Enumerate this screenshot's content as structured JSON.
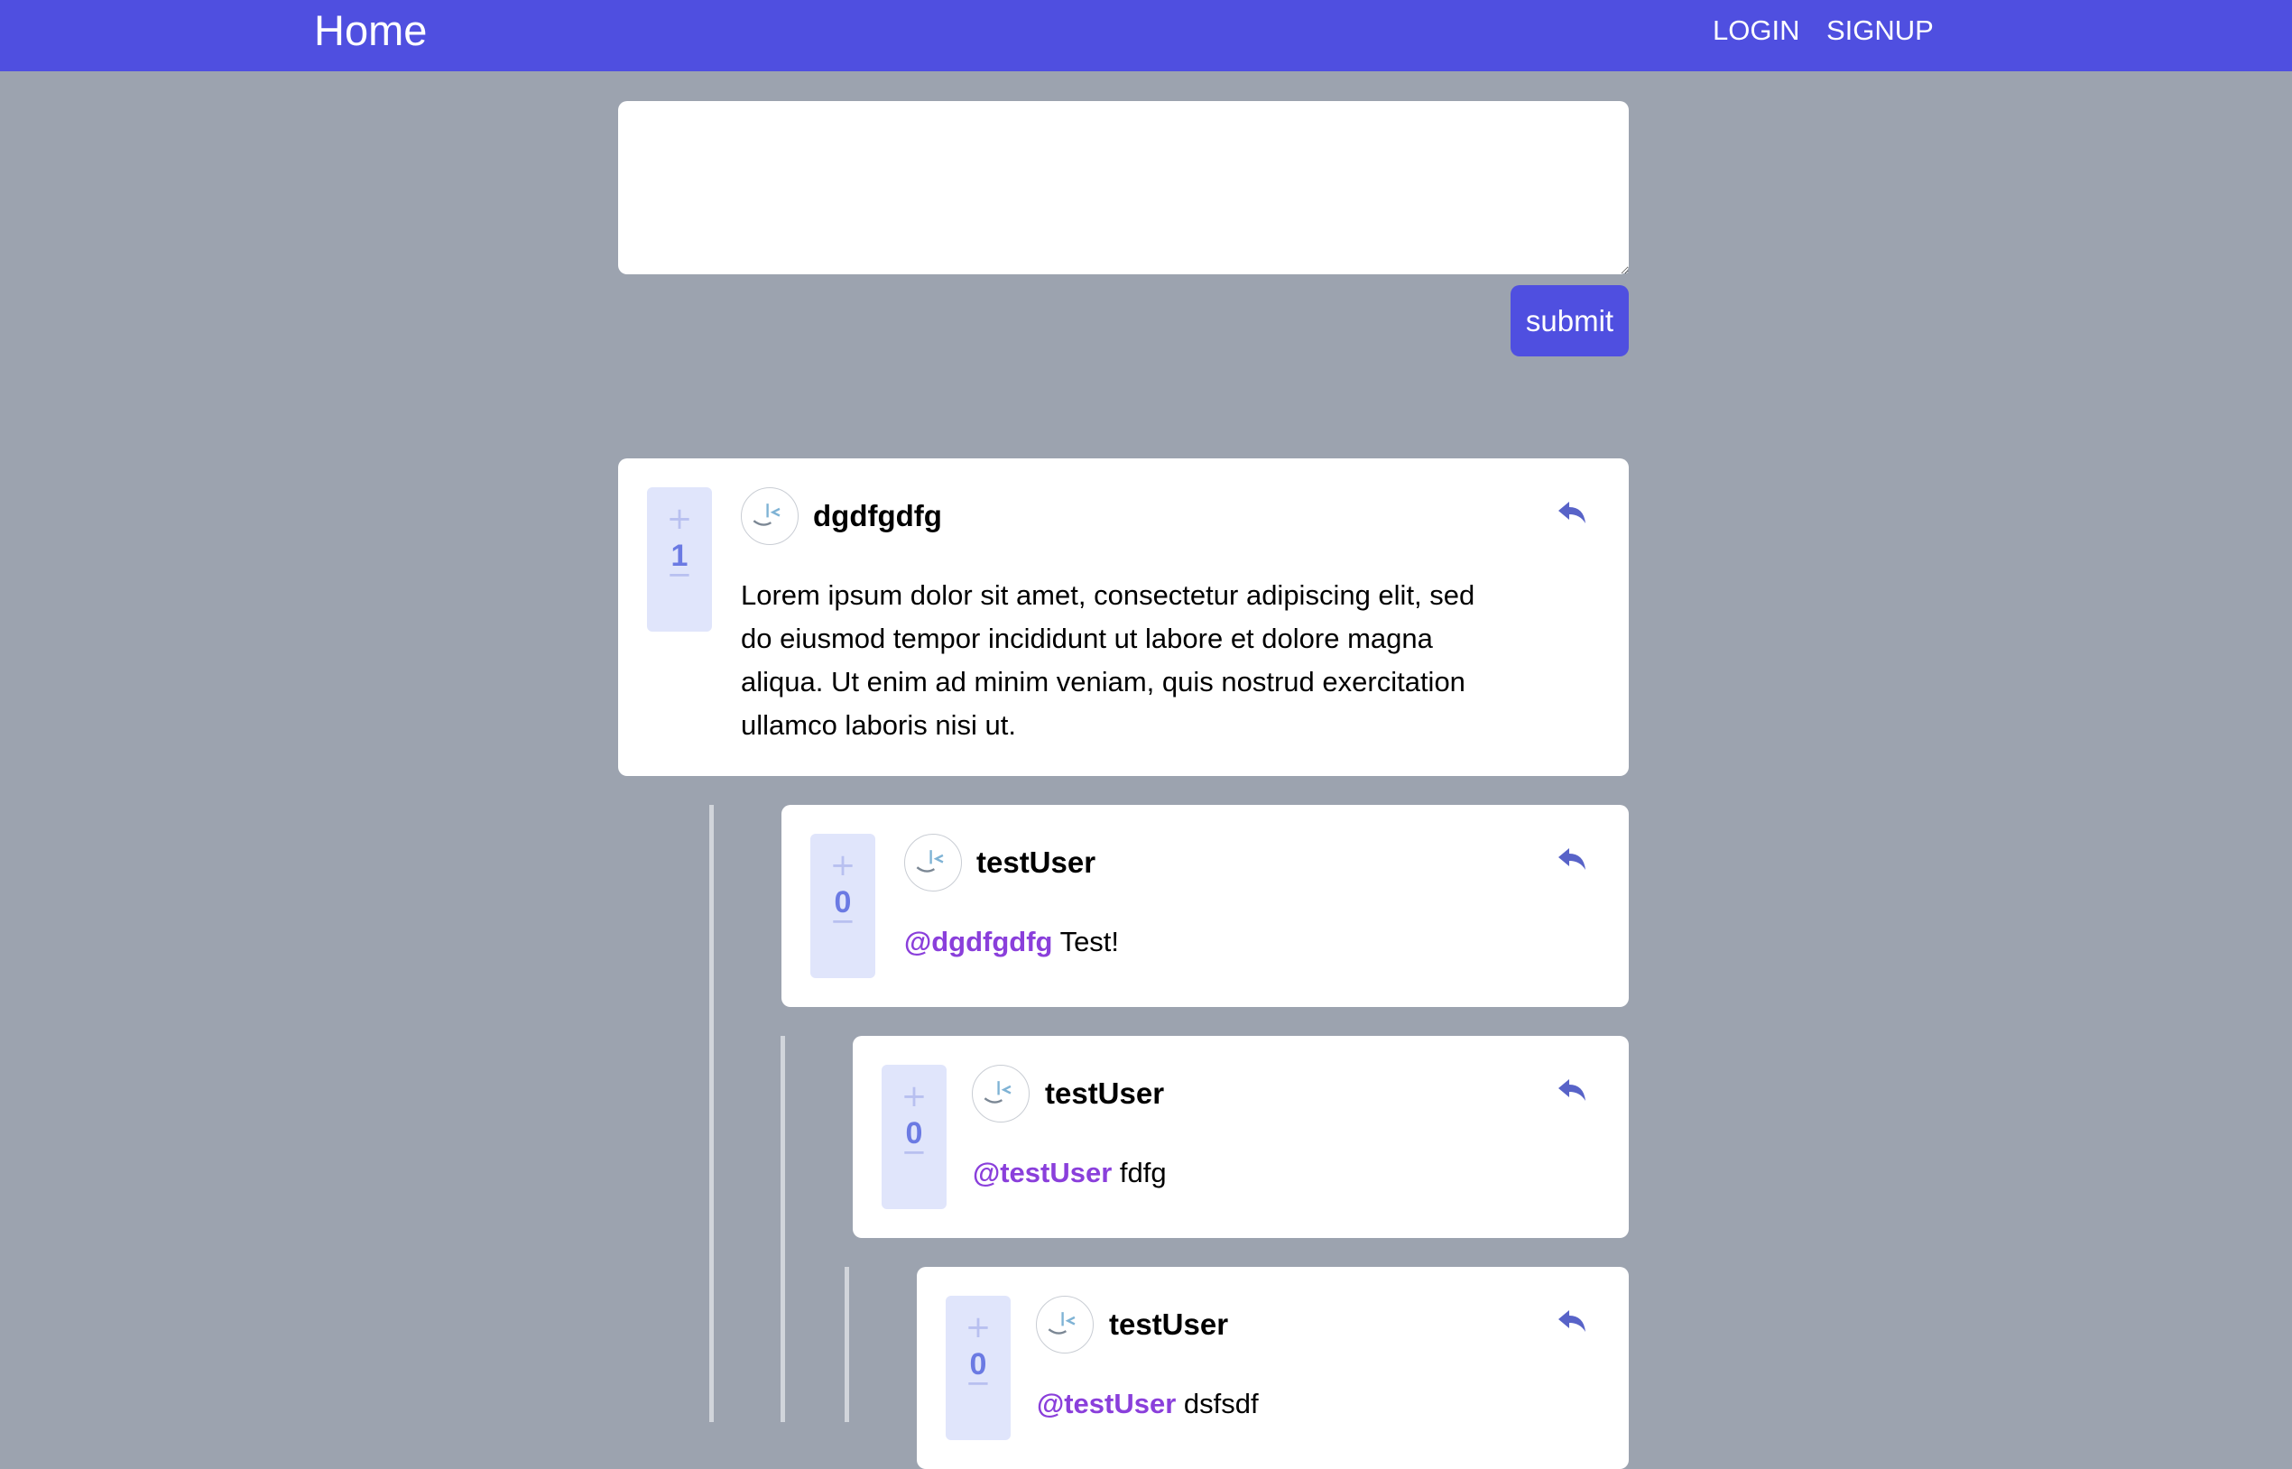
{
  "nav": {
    "home": "Home",
    "login": "LOGIN",
    "signup": "SIGNUP"
  },
  "composer": {
    "value": "",
    "submit_label": "submit"
  },
  "colors": {
    "navbar": "#4f4fe0",
    "background": "#9ca3af",
    "mention": "#8a3fdb",
    "vote_bg": "#e0e5fb"
  },
  "comments": [
    {
      "score": "1",
      "username": "dgdfgdfg",
      "mention": "",
      "text_lines": [
        "Lorem ipsum dolor sit amet, consectetur adipiscing elit, sed",
        "do eiusmod tempor incididunt ut labore et dolore magna",
        "aliqua. Ut enim ad minim veniam, quis nostrud exercitation",
        "ullamco laboris nisi ut."
      ]
    },
    {
      "score": "0",
      "username": "testUser",
      "mention": "@dgdfgdfg",
      "text": "Test!"
    },
    {
      "score": "0",
      "username": "testUser",
      "mention": "@testUser",
      "text": "fdfg"
    },
    {
      "score": "0",
      "username": "testUser",
      "mention": "@testUser",
      "text": "dsfsdf"
    }
  ],
  "icons": {
    "vote_up": "plus-icon",
    "vote_down": "minus-icon",
    "reply": "reply-icon",
    "avatar": "avatar-icon"
  }
}
